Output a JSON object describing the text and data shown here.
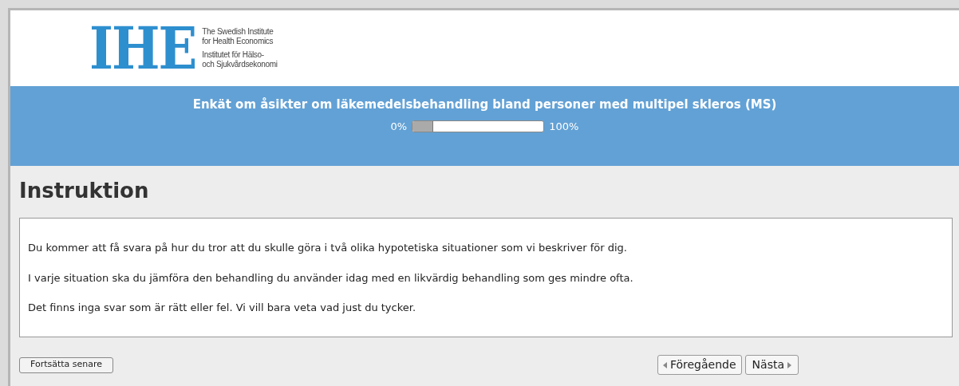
{
  "logo": {
    "mark": "IHE",
    "lines": [
      "The Swedish Institute",
      "for Health Economics",
      "Institutet för Hälso-",
      "och Sjukvårdsekonomi"
    ]
  },
  "survey": {
    "title": "Enkät om åsikter om läkemedelsbehandling bland personer med multipel skleros (MS)",
    "progress": {
      "start_label": "0%",
      "end_label": "100%",
      "level": 0.16
    }
  },
  "section": {
    "heading": "Instruktion",
    "paragraphs": [
      "Du kommer att få svara på hur du tror att du skulle göra i två olika hypotetiska situationer som vi beskriver för dig.",
      "I varje situation ska du jämföra den behandling du använder idag med en likvärdig behandling som ges mindre ofta.",
      "Det finns inga svar som är rätt eller fel. Vi vill bara veta vad just du tycker."
    ]
  },
  "buttons": {
    "later": "Fortsätta senare",
    "previous": "Föregående",
    "next": "Nästa"
  }
}
